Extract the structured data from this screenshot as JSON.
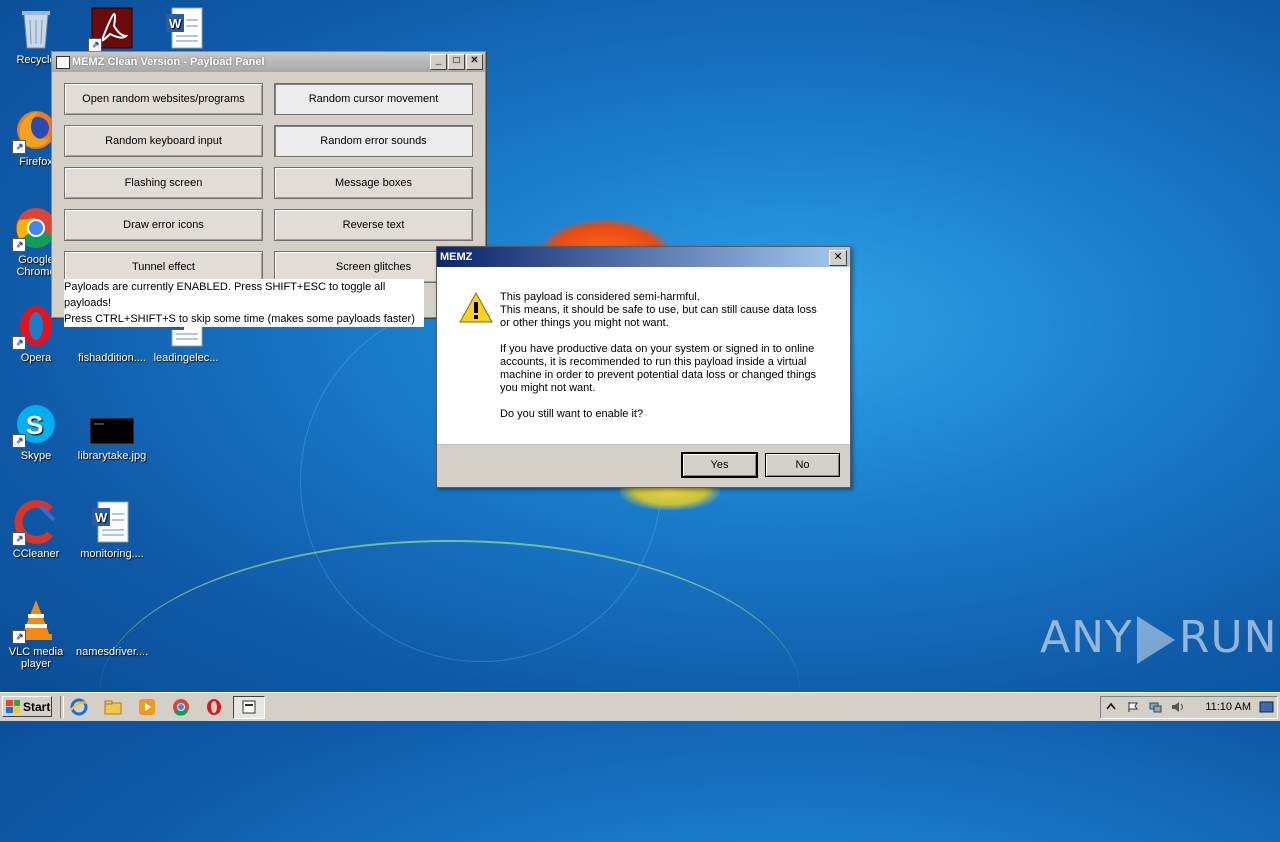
{
  "desktop": {
    "icons": [
      {
        "label": "Recycle",
        "icon": "recycle-bin-icon"
      },
      {
        "label": "",
        "icon": "acrobat-icon"
      },
      {
        "label": "",
        "icon": "word-doc-icon"
      },
      {
        "label": "Firefox",
        "icon": "firefox-icon"
      },
      {
        "label": "Google Chrome",
        "icon": "chrome-icon"
      },
      {
        "label": "Opera",
        "icon": "opera-icon"
      },
      {
        "label": "fishaddition....",
        "icon": "file-icon"
      },
      {
        "label": "leadingelec...",
        "icon": "word-doc-icon"
      },
      {
        "label": "Skype",
        "icon": "skype-icon"
      },
      {
        "label": "librarytake.jpg",
        "icon": "image-icon"
      },
      {
        "label": "CCleaner",
        "icon": "ccleaner-icon"
      },
      {
        "label": "monitoring....",
        "icon": "word-doc-icon"
      },
      {
        "label": "VLC media player",
        "icon": "vlc-icon"
      },
      {
        "label": "namesdriver....",
        "icon": "file-icon"
      }
    ]
  },
  "memz_window": {
    "title": "MEMZ Clean Version - Payload Panel",
    "buttons": [
      "Open random websites/programs",
      "Random cursor movement",
      "Random keyboard input",
      "Random error sounds",
      "Flashing screen",
      "Message boxes",
      "Draw error icons",
      "Reverse text",
      "Tunnel effect",
      "Screen glitches"
    ],
    "status_line1": "Payloads are currently ENABLED. Press SHIFT+ESC to toggle all payloads!",
    "status_line2": "Press CTRL+SHIFT+S to skip some time (makes some payloads faster)"
  },
  "dialog": {
    "title": "MEMZ",
    "paragraph1": "This payload is considered semi-harmful.\nThis means, it should be safe to use, but can still cause data loss\nor other things you might not want.",
    "paragraph2": "If you have productive data on your system or signed in to online\naccounts, it is recommended to run this payload inside a virtual\nmachine in order to prevent potential data loss or changed things\nyou might not want.",
    "paragraph3": "Do you still want to enable it?",
    "yes_label": "Yes",
    "no_label": "No"
  },
  "taskbar": {
    "start_label": "Start",
    "clock": "11:10 AM"
  },
  "watermark": {
    "left": "ANY",
    "right": "RUN"
  }
}
